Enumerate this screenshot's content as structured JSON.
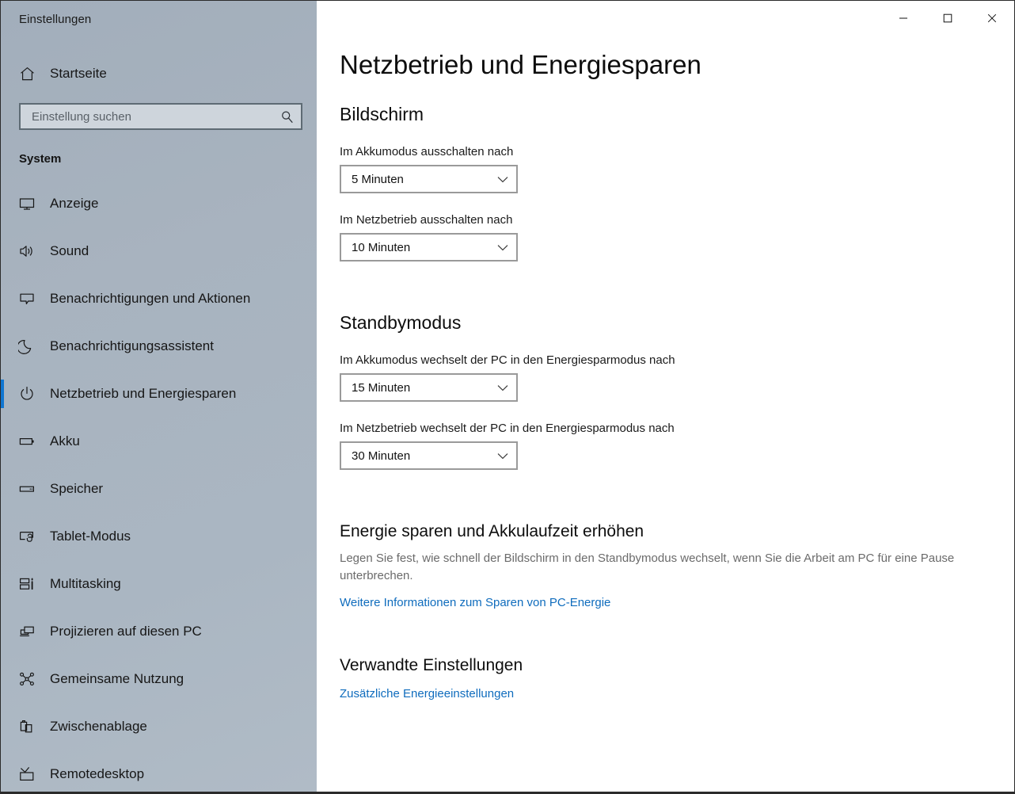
{
  "window": {
    "app_title": "Einstellungen",
    "accent_color": "#1076d1",
    "link_color": "#0f6cbd",
    "sidebar_color": "#a8b3bf",
    "controls": {
      "minimize_label": "Minimieren",
      "maximize_label": "Maximieren",
      "close_label": "Schließen"
    }
  },
  "sidebar": {
    "home": {
      "label": "Startseite",
      "icon": "home-icon"
    },
    "search": {
      "placeholder": "Einstellung suchen",
      "value": "",
      "icon": "search-icon"
    },
    "section_title": "System",
    "items": [
      {
        "label": "Anzeige",
        "icon": "monitor-icon",
        "selected": false
      },
      {
        "label": "Sound",
        "icon": "speaker-icon",
        "selected": false
      },
      {
        "label": "Benachrichtigungen und Aktionen",
        "icon": "notification-icon",
        "selected": false
      },
      {
        "label": "Benachrichtigungsassistent",
        "icon": "moon-icon",
        "selected": false
      },
      {
        "label": "Netzbetrieb und Energiesparen",
        "icon": "power-icon",
        "selected": true
      },
      {
        "label": "Akku",
        "icon": "battery-icon",
        "selected": false
      },
      {
        "label": "Speicher",
        "icon": "storage-icon",
        "selected": false
      },
      {
        "label": "Tablet-Modus",
        "icon": "tablet-mode-icon",
        "selected": false
      },
      {
        "label": "Multitasking",
        "icon": "multitasking-icon",
        "selected": false
      },
      {
        "label": "Projizieren auf diesen PC",
        "icon": "project-icon",
        "selected": false
      },
      {
        "label": "Gemeinsame Nutzung",
        "icon": "share-icon",
        "selected": false
      },
      {
        "label": "Zwischenablage",
        "icon": "clipboard-icon",
        "selected": false
      },
      {
        "label": "Remotedesktop",
        "icon": "remote-desktop-icon",
        "selected": false
      }
    ]
  },
  "main": {
    "page_title": "Netzbetrieb und Energiesparen",
    "screen_group": {
      "heading": "Bildschirm",
      "fields": [
        {
          "label": "Im Akkumodus ausschalten nach",
          "value": "5 Minuten"
        },
        {
          "label": "Im Netzbetrieb ausschalten nach",
          "value": "10 Minuten"
        }
      ]
    },
    "standby_group": {
      "heading": "Standbymodus",
      "fields": [
        {
          "label": "Im Akkumodus wechselt der PC in den Energiesparmodus nach",
          "value": "15 Minuten"
        },
        {
          "label": "Im Netzbetrieb wechselt der PC in den Energiesparmodus nach",
          "value": "30 Minuten"
        }
      ]
    },
    "save_energy": {
      "title": "Energie sparen und Akkulaufzeit erhöhen",
      "description": "Legen Sie fest, wie schnell der Bildschirm in den Standbymodus wechselt, wenn Sie die Arbeit am PC für eine Pause unterbrechen.",
      "link": "Weitere Informationen zum Sparen von PC-Energie"
    },
    "related": {
      "title": "Verwandte Einstellungen",
      "link": "Zusätzliche Energieeinstellungen"
    }
  }
}
